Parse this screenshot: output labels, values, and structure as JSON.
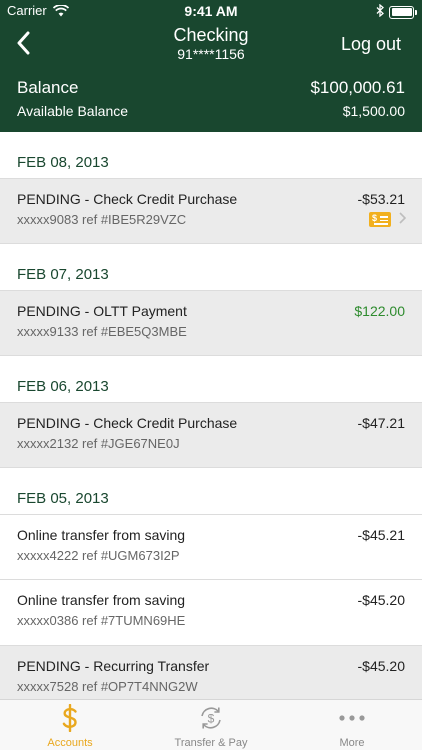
{
  "status_bar": {
    "carrier": "Carrier",
    "time": "9:41 AM"
  },
  "nav": {
    "title": "Checking",
    "account_number": "91****1156",
    "logout_label": "Log out"
  },
  "balance": {
    "balance_label": "Balance",
    "balance_value": "$100,000.61",
    "available_label": "Available Balance",
    "available_value": "$1,500.00"
  },
  "sections": [
    {
      "date": "FEB 08, 2013",
      "transactions": [
        {
          "title": "PENDING - Check Credit Purchase",
          "ref": "xxxxx9083 ref #IBE5R29VZC",
          "amount": "-$53.21"
        }
      ]
    },
    {
      "date": "FEB 07, 2013",
      "transactions": [
        {
          "title": "PENDING - OLTT Payment",
          "ref": "xxxxx9133 ref #EBE5Q3MBE",
          "amount": "$122.00"
        }
      ]
    },
    {
      "date": "FEB 06, 2013",
      "transactions": [
        {
          "title": "PENDING - Check Credit Purchase",
          "ref": "xxxxx2132 ref #JGE67NE0J",
          "amount": "-$47.21"
        }
      ]
    },
    {
      "date": "FEB 05, 2013",
      "transactions": [
        {
          "title": "Online transfer from saving",
          "ref": "xxxxx4222 ref #UGM673I2P",
          "amount": "-$45.21"
        },
        {
          "title": "Online transfer from saving",
          "ref": "xxxxx0386 ref #7TUMN69HE",
          "amount": "-$45.20"
        },
        {
          "title": "PENDING - Recurring Transfer",
          "ref": "xxxxx7528 ref #OP7T4NNG2W",
          "amount": "-$45.20"
        }
      ]
    }
  ],
  "check_badge_glyph": "$",
  "tabs": [
    {
      "label": "Accounts",
      "icon": "dollar-icon"
    },
    {
      "label": "Transfer & Pay",
      "icon": "transfer-icon"
    },
    {
      "label": "More",
      "icon": "more-dots-icon"
    }
  ],
  "colors": {
    "header": "#19472f",
    "accent": "#e9a81f",
    "positive": "#2e8b2e"
  }
}
